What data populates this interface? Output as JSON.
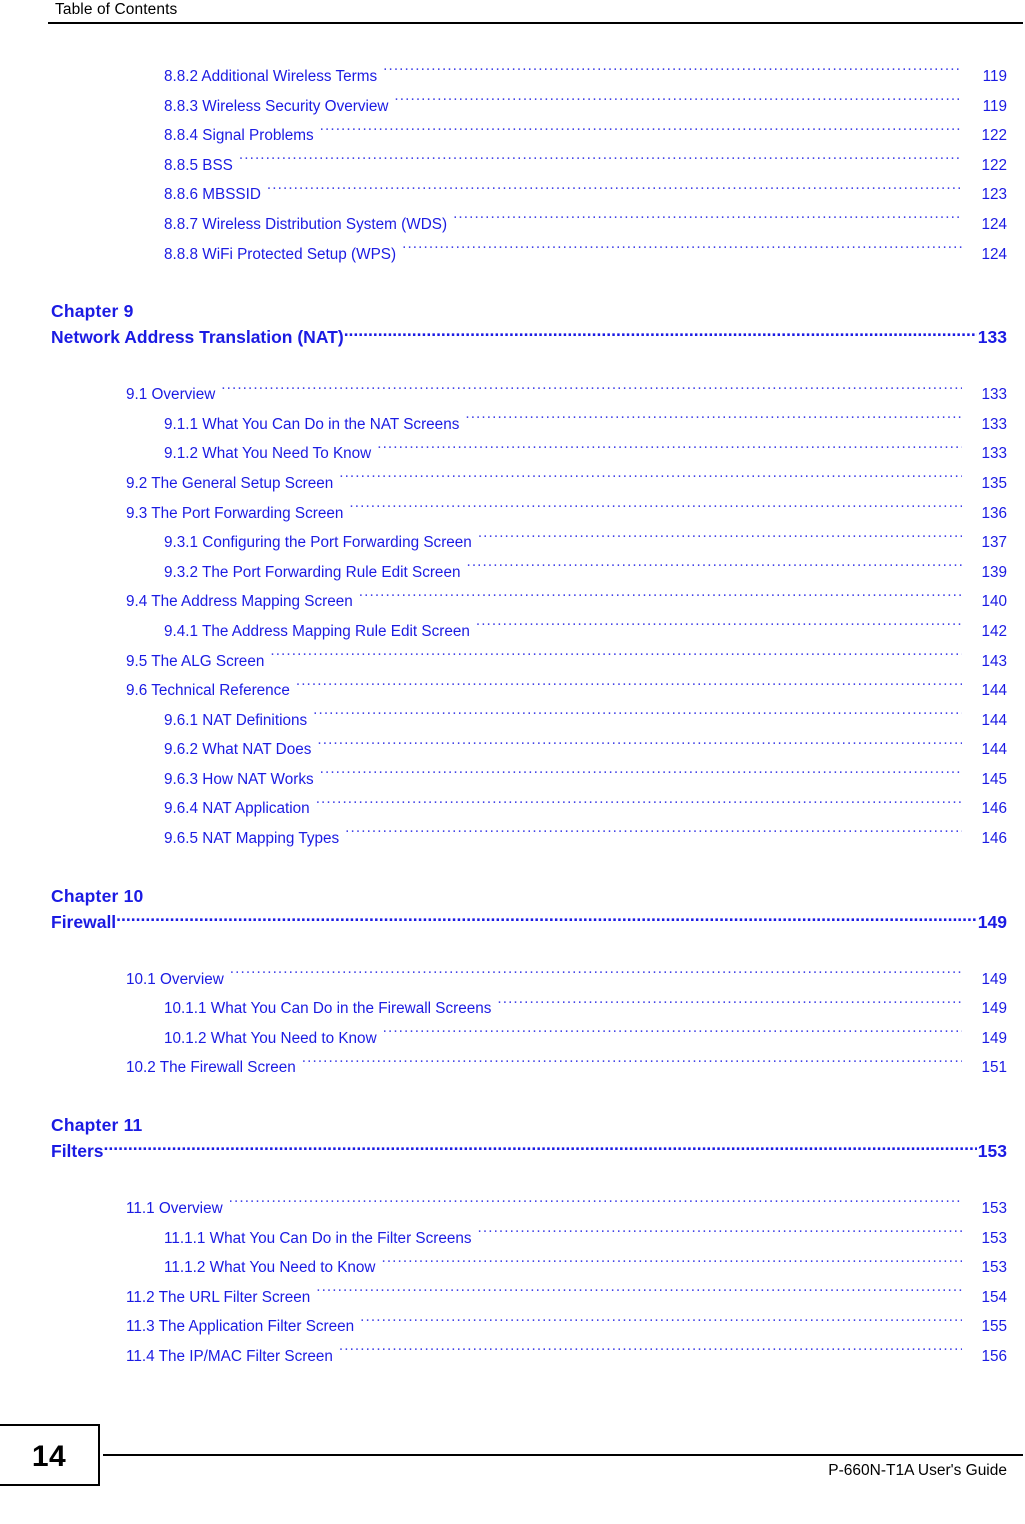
{
  "header": {
    "title": "Table of Contents"
  },
  "footer": {
    "page_number": "14",
    "guide_title": "P-660N-T1A User's Guide"
  },
  "colors": {
    "link_blue": "#1b1be3",
    "leader_blue": "#4141e8",
    "text_black": "#000000",
    "background": "#ffffff"
  },
  "toc": {
    "blocks": [
      {
        "type": "entries",
        "entries": [
          {
            "level": 3,
            "label": "8.8.2 Additional Wireless Terms",
            "page": "119"
          },
          {
            "level": 3,
            "label": "8.8.3 Wireless Security Overview ",
            "page": "119"
          },
          {
            "level": 3,
            "label": "8.8.4 Signal Problems",
            "page": "122"
          },
          {
            "level": 3,
            "label": "8.8.5 BSS ",
            "page": "122"
          },
          {
            "level": 3,
            "label": "8.8.6 MBSSID ",
            "page": "123"
          },
          {
            "level": 3,
            "label": "8.8.7 Wireless Distribution System (WDS)",
            "page": "124"
          },
          {
            "level": 3,
            "label": "8.8.8 WiFi Protected Setup (WPS)",
            "page": "124"
          }
        ]
      },
      {
        "type": "chapter",
        "number": "Chapter  9",
        "title": "Network Address Translation (NAT)",
        "page": "133"
      },
      {
        "type": "entries",
        "entries": [
          {
            "level": 2,
            "label": "9.1 Overview",
            "page": "133"
          },
          {
            "level": 3,
            "label": "9.1.1 What You Can Do in the NAT Screens",
            "page": "133"
          },
          {
            "level": 3,
            "label": "9.1.2 What You Need To Know ",
            "page": "133"
          },
          {
            "level": 2,
            "label": "9.2 The General Setup Screen ",
            "page": "135"
          },
          {
            "level": 2,
            "label": "9.3 The Port Forwarding Screen  ",
            "page": "136"
          },
          {
            "level": 3,
            "label": "9.3.1 Configuring the Port Forwarding Screen ",
            "page": "137"
          },
          {
            "level": 3,
            "label": "9.3.2 The Port Forwarding Rule Edit Screen  ",
            "page": "139"
          },
          {
            "level": 2,
            "label": "9.4 The Address Mapping Screen ",
            "page": "140"
          },
          {
            "level": 3,
            "label": "9.4.1 The Address Mapping Rule Edit Screen ",
            "page": "142"
          },
          {
            "level": 2,
            "label": "9.5 The ALG Screen ",
            "page": "143"
          },
          {
            "level": 2,
            "label": "9.6 Technical Reference ",
            "page": "144"
          },
          {
            "level": 3,
            "label": "9.6.1 NAT Definitions ",
            "page": "144"
          },
          {
            "level": 3,
            "label": "9.6.2 What NAT Does ",
            "page": "144"
          },
          {
            "level": 3,
            "label": "9.6.3 How NAT Works ",
            "page": "145"
          },
          {
            "level": 3,
            "label": "9.6.4 NAT Application ",
            "page": "146"
          },
          {
            "level": 3,
            "label": "9.6.5 NAT Mapping Types ",
            "page": "146"
          }
        ]
      },
      {
        "type": "chapter",
        "number": "Chapter  10",
        "title": "Firewall",
        "page": "149"
      },
      {
        "type": "entries",
        "entries": [
          {
            "level": 2,
            "label": "10.1 Overview ",
            "page": "149"
          },
          {
            "level": 3,
            "label": "10.1.1 What You Can Do in the Firewall Screens  ",
            "page": "149"
          },
          {
            "level": 3,
            "label": "10.1.2 What You Need to Know ",
            "page": "149"
          },
          {
            "level": 2,
            "label": "10.2 The Firewall Screen ",
            "page": "151"
          }
        ]
      },
      {
        "type": "chapter",
        "number": "Chapter  11",
        "title": "Filters",
        "page": "153"
      },
      {
        "type": "entries",
        "entries": [
          {
            "level": 2,
            "label": "11.1 Overview  ",
            "page": "153"
          },
          {
            "level": 3,
            "label": "11.1.1 What You Can Do in the Filter Screens ",
            "page": "153"
          },
          {
            "level": 3,
            "label": "11.1.2 What You Need to Know ",
            "page": "153"
          },
          {
            "level": 2,
            "label": "11.2 The URL Filter Screen  ",
            "page": "154"
          },
          {
            "level": 2,
            "label": "11.3 The Application Filter Screen ",
            "page": "155"
          },
          {
            "level": 2,
            "label": "11.4 The IP/MAC Filter Screen ",
            "page": "156"
          }
        ]
      }
    ]
  }
}
